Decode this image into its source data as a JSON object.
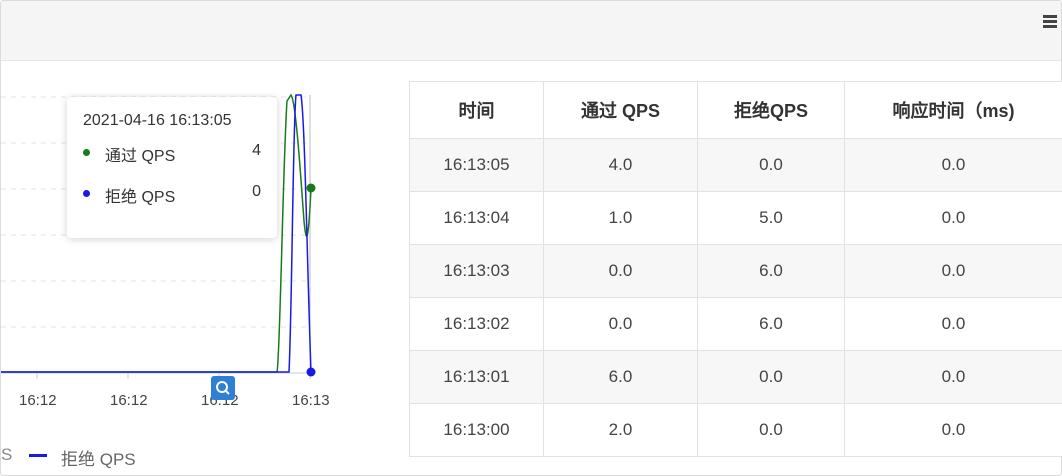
{
  "chart": {
    "x_ticks": [
      "16:12",
      "16:12",
      "16:12",
      "16:13"
    ],
    "tooltip": {
      "time": "2021-04-16 16:13:05",
      "rows": [
        {
          "name": "通过 QPS",
          "value": "4",
          "color": "#1a7a1a"
        },
        {
          "name": "拒绝 QPS",
          "value": "0",
          "color": "#1a1ae8"
        }
      ]
    },
    "legend": {
      "partial_prev": "S",
      "label": "拒绝 QPS",
      "color": "#1a1ae8"
    },
    "icons": [
      "menu-icon",
      "zoom-icon"
    ]
  },
  "table": {
    "headers": [
      "时间",
      "通过 QPS",
      "拒绝QPS",
      "响应时间（ms)"
    ],
    "rows": [
      [
        "16:13:05",
        "4.0",
        "0.0",
        "0.0"
      ],
      [
        "16:13:04",
        "1.0",
        "5.0",
        "0.0"
      ],
      [
        "16:13:03",
        "0.0",
        "6.0",
        "0.0"
      ],
      [
        "16:13:02",
        "0.0",
        "6.0",
        "0.0"
      ],
      [
        "16:13:01",
        "6.0",
        "0.0",
        "0.0"
      ],
      [
        "16:13:00",
        "2.0",
        "0.0",
        "0.0"
      ]
    ]
  }
}
